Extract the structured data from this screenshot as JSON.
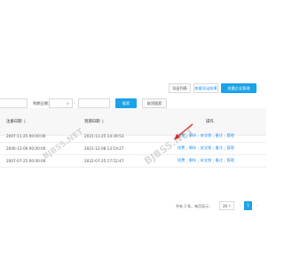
{
  "toolbar": {
    "export_label": "导出列表",
    "view_export_label": "查看导出结果",
    "batch_label": "批量企业管理"
  },
  "search": {
    "expire_date_label": "到期日期：",
    "clear_icon": "close-circle-icon",
    "search_label": "搜索",
    "cancel_search_label": "取消搜索"
  },
  "table": {
    "columns": [
      "注册日期",
      "到期日期",
      "操作"
    ],
    "rows": [
      {
        "reg_date": "2007-11-25 00:00:00",
        "exp_date": "2021-11-25 14:39:53"
      },
      {
        "reg_date": "2006-12-06 00:00:00",
        "exp_date": "2021-12-08 13:19:27"
      },
      {
        "reg_date": "2007-07-25 00:00:00",
        "exp_date": "2022-07-25 17:52:47"
      }
    ],
    "actions": [
      "续费",
      "解析",
      "安全锁",
      "备注",
      "管理"
    ]
  },
  "pagination": {
    "total_text": "共有 3 条，每页显示：",
    "page_size": "20",
    "prev": "‹",
    "current_page": "1",
    "next": "›"
  },
  "watermark": "BJBSS.NET",
  "colors": {
    "primary": "#1aa3e8",
    "link": "#1890ff",
    "arrow": "#e8201a"
  }
}
